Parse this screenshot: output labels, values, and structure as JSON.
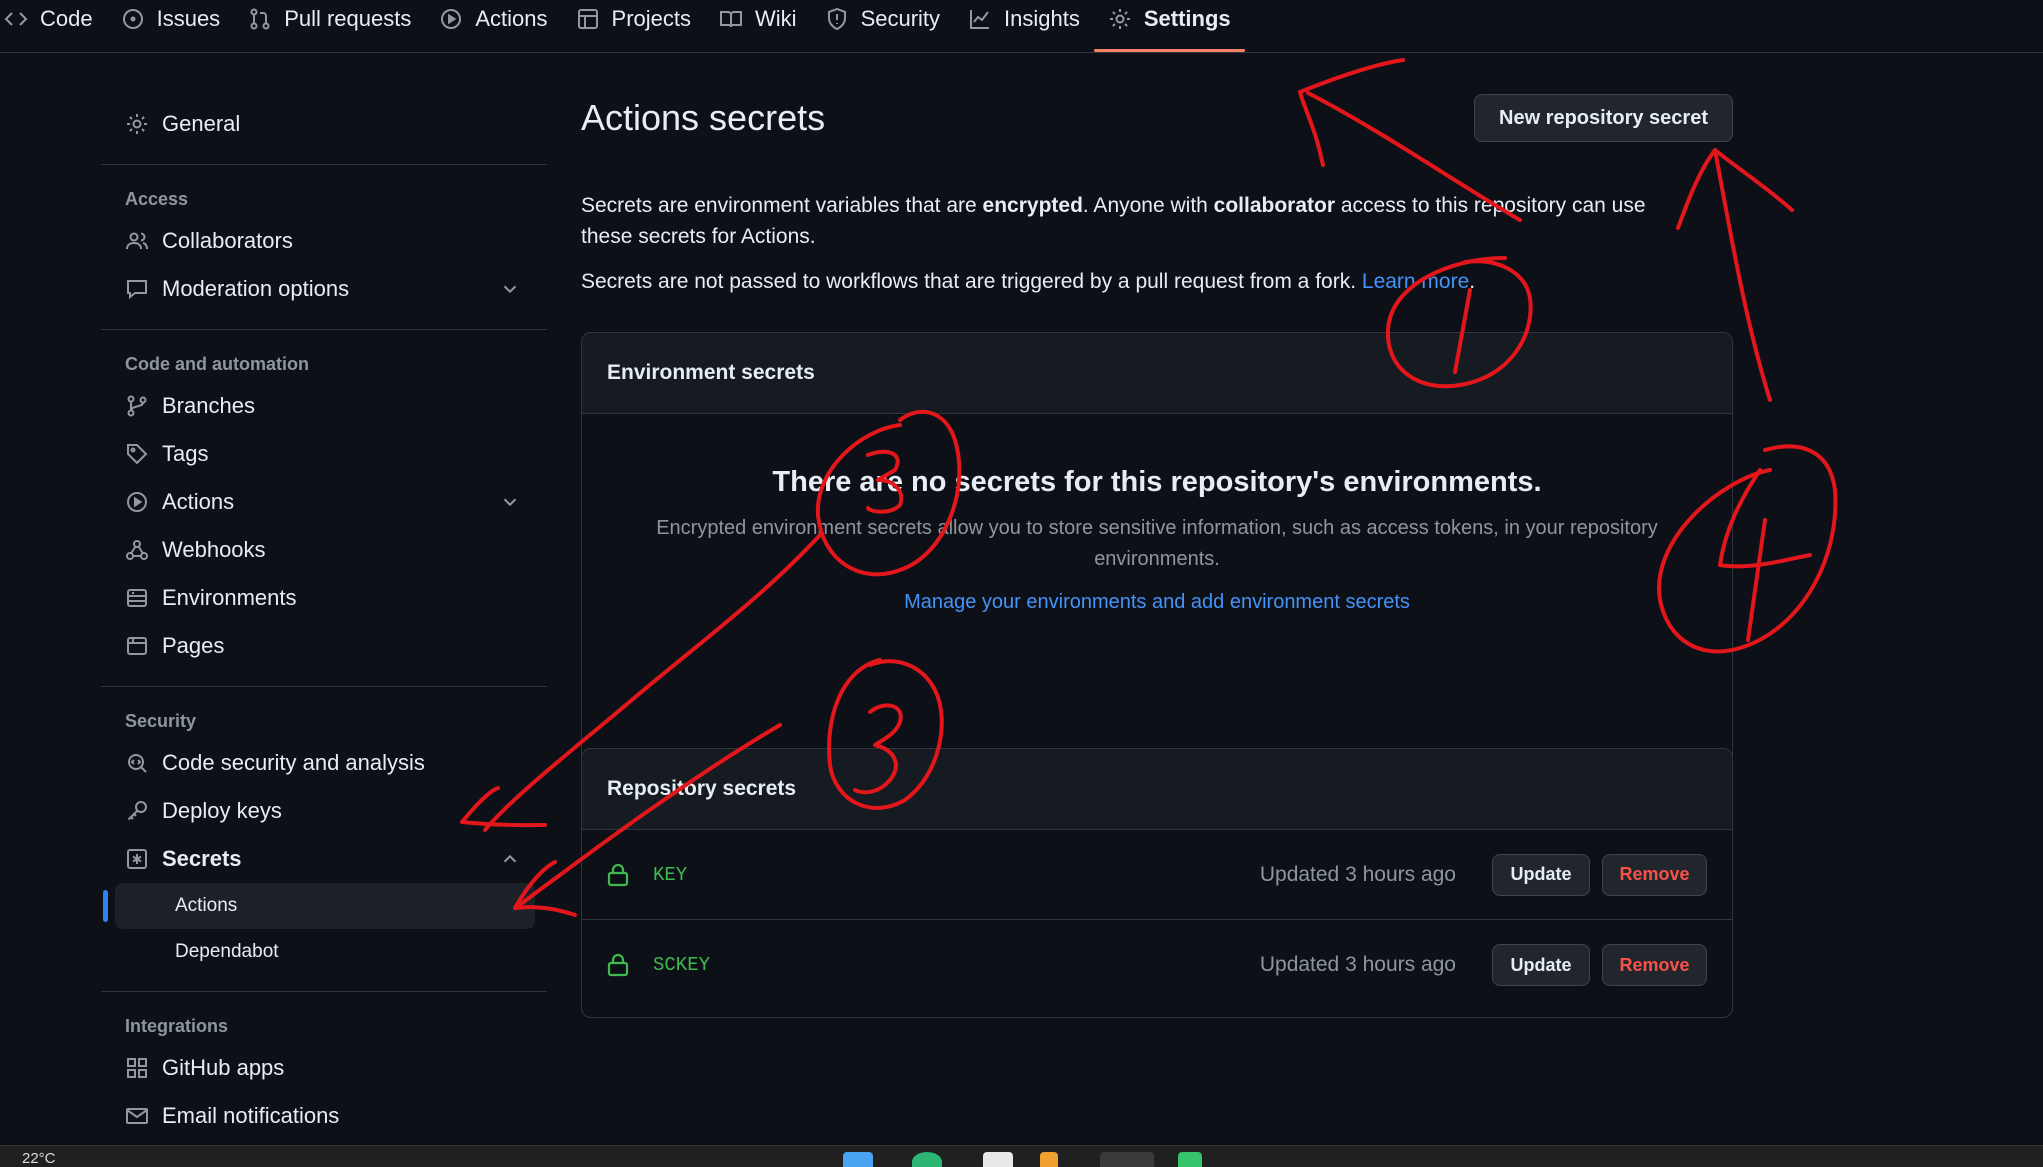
{
  "repo_nav": {
    "items": [
      {
        "label": "Code",
        "icon": "code-icon"
      },
      {
        "label": "Issues",
        "icon": "issue-icon"
      },
      {
        "label": "Pull requests",
        "icon": "pull-request-icon"
      },
      {
        "label": "Actions",
        "icon": "play-icon"
      },
      {
        "label": "Projects",
        "icon": "table-icon"
      },
      {
        "label": "Wiki",
        "icon": "book-icon"
      },
      {
        "label": "Security",
        "icon": "shield-icon"
      },
      {
        "label": "Insights",
        "icon": "graph-icon"
      },
      {
        "label": "Settings",
        "icon": "gear-icon"
      }
    ],
    "selected": "Settings"
  },
  "sidebar": {
    "general": "General",
    "access_heading": "Access",
    "collaborators": "Collaborators",
    "moderation": "Moderation options",
    "code_heading": "Code and automation",
    "branches": "Branches",
    "tags": "Tags",
    "actions": "Actions",
    "webhooks": "Webhooks",
    "environments": "Environments",
    "pages": "Pages",
    "security_heading": "Security",
    "code_security": "Code security and analysis",
    "deploy_keys": "Deploy keys",
    "secrets": "Secrets",
    "secrets_actions": "Actions",
    "secrets_dependabot": "Dependabot",
    "integrations_heading": "Integrations",
    "github_apps": "GitHub apps",
    "email_notifications": "Email notifications"
  },
  "main": {
    "title": "Actions secrets",
    "new_secret_button": "New repository secret",
    "desc_part1": "Secrets are environment variables that are ",
    "desc_bold1": "encrypted",
    "desc_part2": ". Anyone with ",
    "desc_bold2": "collaborator",
    "desc_part3": " access to this repository can use these secrets for Actions.",
    "desc2_text": "Secrets are not passed to workflows that are triggered by a pull request from a fork. ",
    "learn_more": "Learn more",
    "learn_more_suffix": ".",
    "env_heading": "Environment secrets",
    "env_blank_title": "There are no secrets for this repository's environments.",
    "env_blank_text": "Encrypted environment secrets allow you to store sensitive information, such as access tokens, in your repository environments.",
    "env_manage_link": "Manage your environments and add environment secrets",
    "repo_heading": "Repository secrets",
    "secrets": [
      {
        "name": "KEY",
        "updated": "Updated 3 hours ago",
        "update_label": "Update",
        "remove_label": "Remove"
      },
      {
        "name": "SCKEY",
        "updated": "Updated 3 hours ago",
        "update_label": "Update",
        "remove_label": "Remove"
      }
    ]
  },
  "taskbar": {
    "temperature": "22°C"
  },
  "annotations": {
    "color": "#e3171b",
    "numbers": [
      "1",
      "2",
      "3",
      "4"
    ]
  },
  "colors": {
    "accent_tab": "#f78166",
    "link": "#4493f8",
    "secret_name": "#3fb950",
    "danger": "#f85149",
    "annotation": "#e3171b"
  }
}
